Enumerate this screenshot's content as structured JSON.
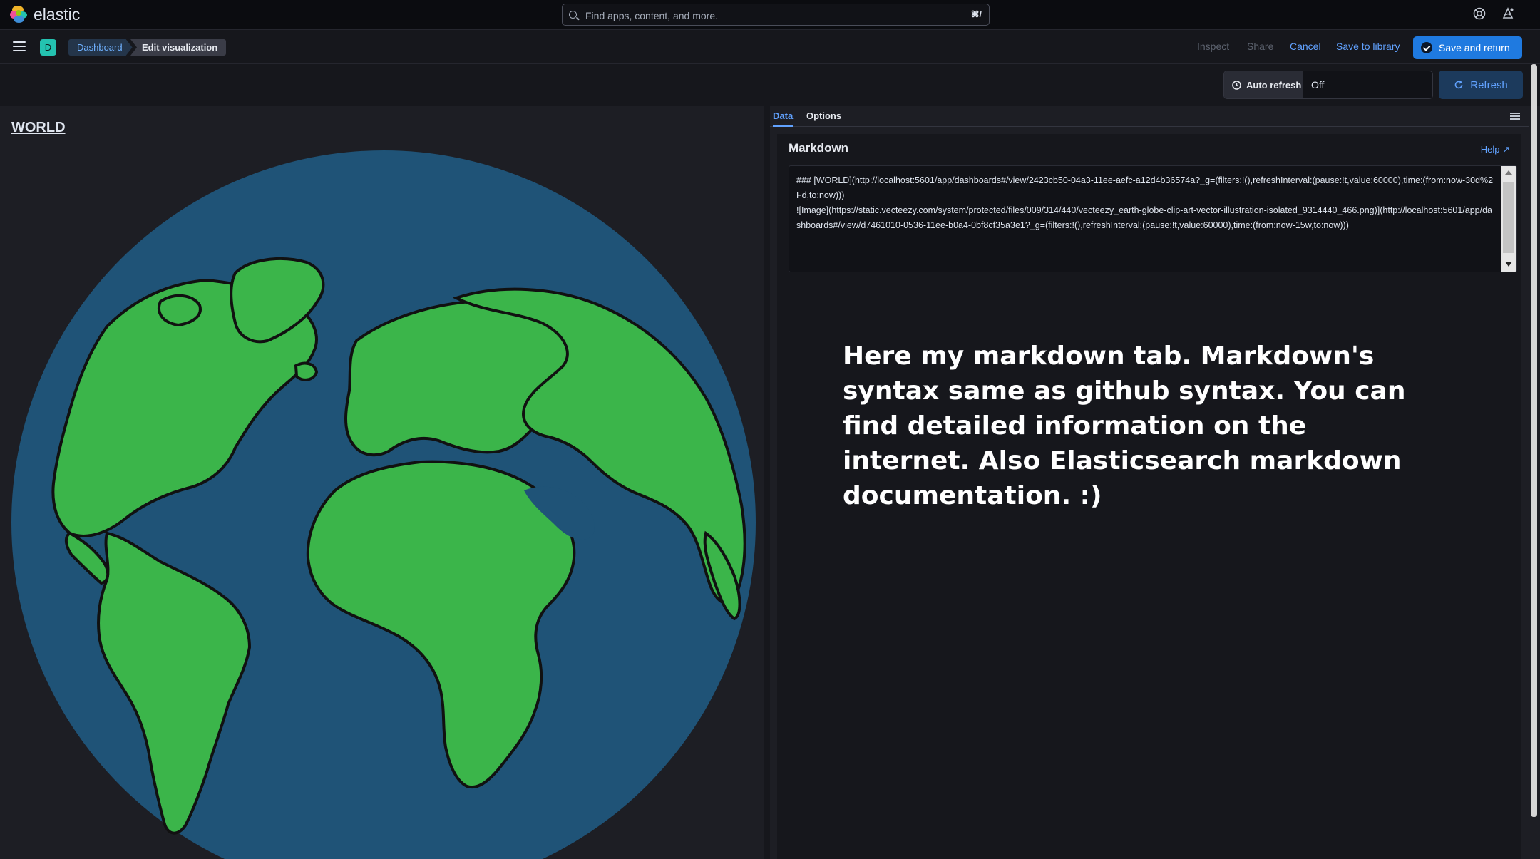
{
  "header": {
    "logo_text": "elastic",
    "search_placeholder": "Find apps, content, and more.",
    "search_shortcut": "⌘/",
    "help_icon": "help-icon",
    "news_icon": "newsfeed-icon"
  },
  "breadcrumbs": [
    "Dashboard",
    "Edit visualization"
  ],
  "space_avatar": "D",
  "top_actions": {
    "inspect": "Inspect",
    "share": "Share",
    "cancel": "Cancel",
    "save_to_library": "Save to library",
    "save_and_return": "Save and return"
  },
  "auto_refresh": {
    "label": "Auto refresh",
    "value": "Off"
  },
  "refresh_label": "Refresh",
  "visualization": {
    "title": "WORLD"
  },
  "editor": {
    "tabs": [
      "Data",
      "Options"
    ],
    "active_tab": "Data",
    "section_title": "Markdown",
    "help_label": "Help",
    "markdown_content": "### [WORLD](http://localhost:5601/app/dashboards#/view/2423cb50-04a3-11ee-aefc-a12d4b36574a?_g=(filters:!(),refreshInterval:(pause:!t,value:60000),time:(from:now-30d%2Fd,to:now)))\n![Image](https://static.vecteezy.com/system/protected/files/009/314/440/vecteezy_earth-globe-clip-art-vector-illustration-isolated_9314440_466.png)](http://localhost:5601/app/dashboards#/view/d7461010-0536-11ee-b0a4-0bf8cf35a3e1?_g=(filters:!(),refreshInterval:(pause:!t,value:60000),time:(from:now-15w,to:now)))"
  },
  "overlay_note": " Here my markdown tab. Markdown's syntax same as github syntax. You can find detailed information on the internet. Also Elasticsearch markdown documentation. :)",
  "colors": {
    "accent": "#1f7ae0",
    "ocean": "#1f5377",
    "land": "#3bb54a",
    "background": "#1d1e24"
  }
}
